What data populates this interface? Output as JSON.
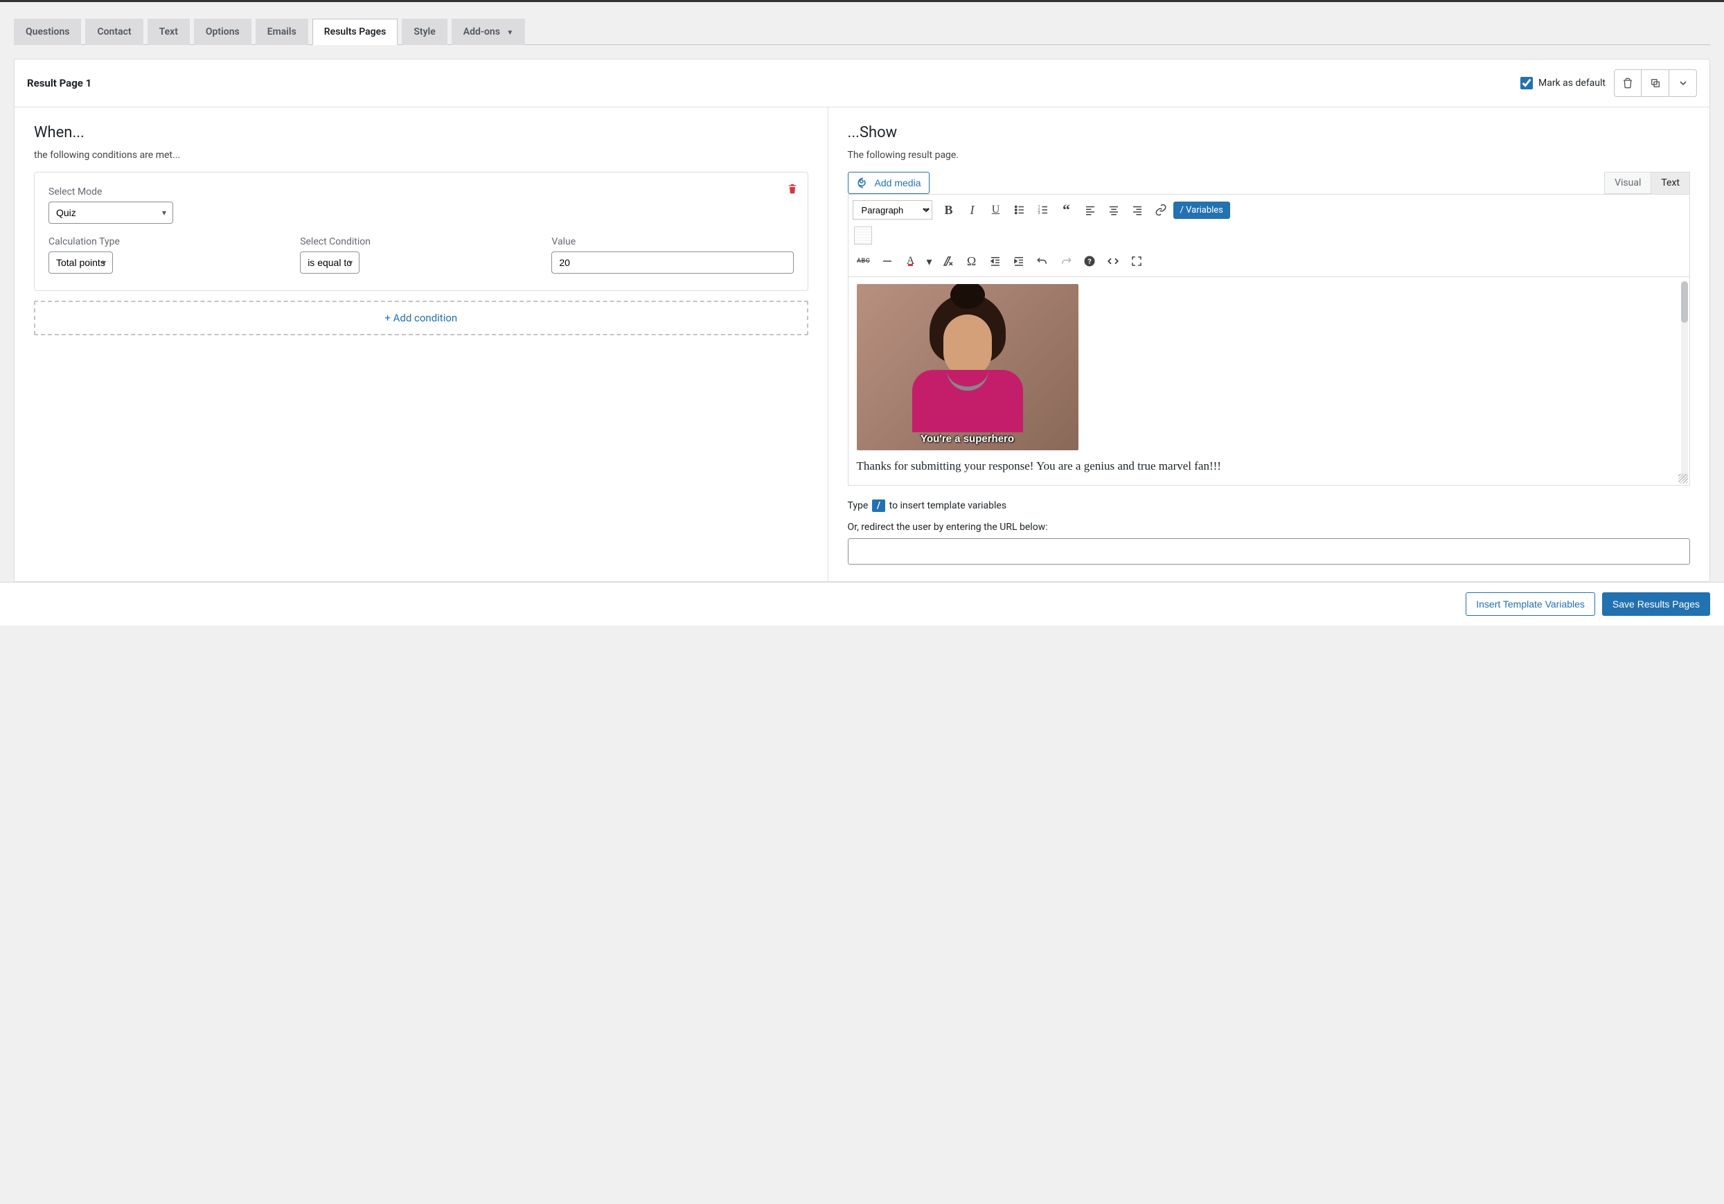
{
  "tabs": {
    "items": [
      {
        "label": "Questions"
      },
      {
        "label": "Contact"
      },
      {
        "label": "Text"
      },
      {
        "label": "Options"
      },
      {
        "label": "Emails"
      },
      {
        "label": "Results Pages"
      },
      {
        "label": "Style"
      },
      {
        "label": "Add-ons"
      }
    ],
    "active_index": 5
  },
  "card": {
    "title": "Result Page 1",
    "mark_default_label": "Mark as default",
    "mark_default_checked": true
  },
  "when": {
    "title": "When...",
    "subtitle": "the following conditions are met...",
    "mode_label": "Select Mode",
    "mode_value": "Quiz",
    "calc_type_label": "Calculation Type",
    "calc_type_value": "Total points",
    "condition_label": "Select Condition",
    "condition_value": "is equal to",
    "value_label": "Value",
    "value_value": "20",
    "add_condition_label": "+ Add condition"
  },
  "show": {
    "title": "...Show",
    "subtitle": "The following result page.",
    "add_media_label": "Add media",
    "visual_tab": "Visual",
    "text_tab": "Text",
    "paragraph_label": "Paragraph",
    "variables_btn": "/ Variables",
    "image_caption": "You're a superhero",
    "body_text": "Thanks for submitting your response! You are a genius and true marvel fan!!!",
    "hint_prefix": "Type",
    "hint_slash": "/",
    "hint_suffix": "to insert template variables",
    "redirect_label": "Or, redirect the user by entering the URL below:",
    "redirect_value": ""
  },
  "footer": {
    "insert_vars": "Insert Template Variables",
    "save": "Save Results Pages"
  }
}
